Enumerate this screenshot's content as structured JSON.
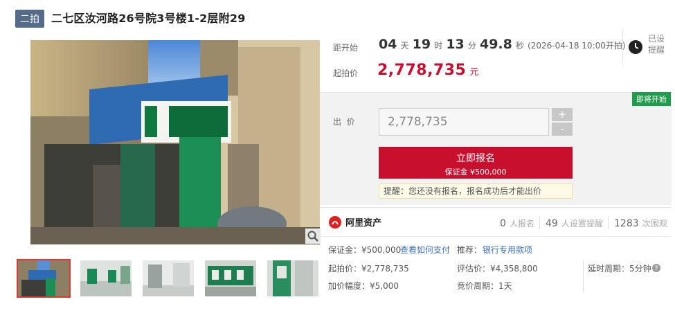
{
  "header": {
    "badge": "二拍",
    "title": "二七区汝河路26号院3号楼1-2层附29"
  },
  "countdown": {
    "label": "距开始",
    "days": "04",
    "days_unit": "天",
    "hours": "19",
    "hours_unit": "时",
    "minutes": "13",
    "minutes_unit": "分",
    "seconds": "49.8",
    "seconds_unit": "秒",
    "start_note": "(2026-04-18 10:00开拍)"
  },
  "reminder": {
    "line1": "已设",
    "line2": "提醒"
  },
  "start_price": {
    "label": "起拍价",
    "value": "2,778,735",
    "unit": "元"
  },
  "bid": {
    "status_badge": "即将开始",
    "label": "出  价",
    "input_value": "2,778,735",
    "plus": "+",
    "minus": "-",
    "signup_label": "立即报名",
    "signup_deposit": "保证金 ¥500,000",
    "tip": "提醒：您还没有报名，报名成功后才能出价"
  },
  "platform": {
    "logo_text": "阿里资产"
  },
  "stats": [
    {
      "count": "0",
      "label": "人报名"
    },
    {
      "count": "49",
      "label": "人设置提醒"
    },
    {
      "count": "1283",
      "label": "次围观"
    }
  ],
  "deposit_row": {
    "deposit": "保证金：¥500,000",
    "pay_link": "查看如何支付",
    "recommend_label": "推荐：",
    "recommend_link": "银行专用款项"
  },
  "info": {
    "start_price": "起拍价：¥2,778,735",
    "appraisal": "评估价：¥4,358,800",
    "delay": "延时周期：5分钟",
    "increment": "加价幅度：¥5,000",
    "cycle": "竞价周期：1天"
  },
  "colors": {
    "accent_red": "#c8102e",
    "badge_blue": "#566a8a",
    "soon_green": "#1e9d4c",
    "link_blue": "#3a6fb5"
  }
}
